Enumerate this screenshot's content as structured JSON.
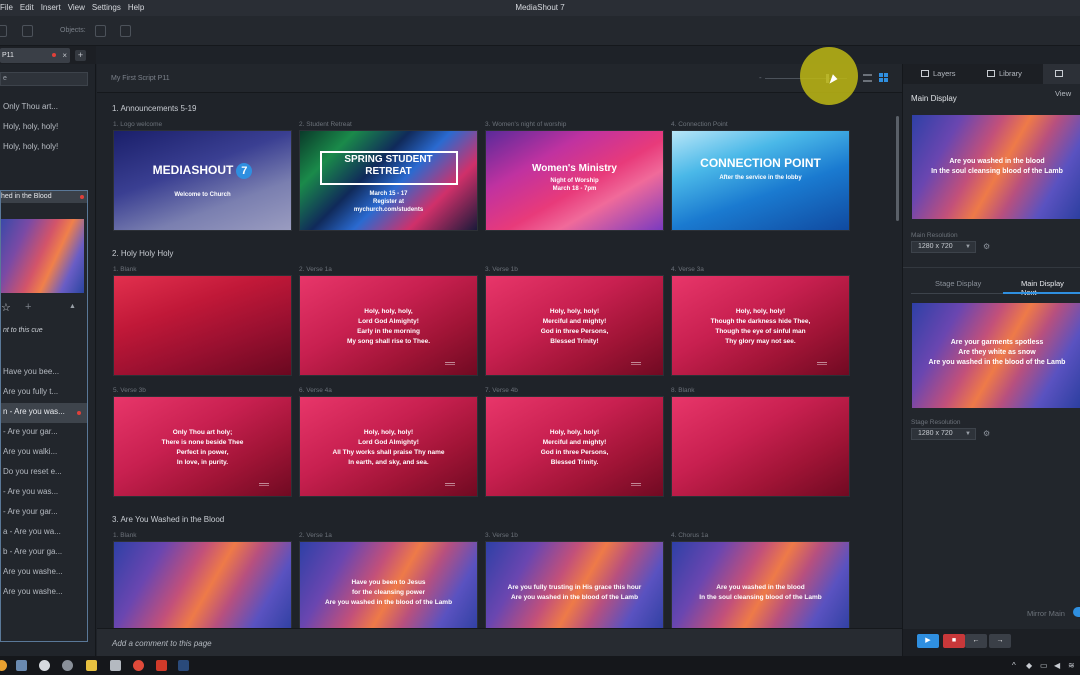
{
  "window": {
    "title": "MediaShout 7"
  },
  "menu": [
    "File",
    "Edit",
    "Insert",
    "View",
    "Settings",
    "Help"
  ],
  "toolbar": {
    "objects_label": "Objects:"
  },
  "tabs": {
    "active_label": "P11",
    "close": "×",
    "add": "+"
  },
  "sidebar": {
    "search_value": "e",
    "top_items": [
      "Only Thou art...",
      "Holy, holy, holy!",
      "Holy, holy, holy!"
    ],
    "cue_title": "hed in the Blood",
    "cue_note": "nt to this cue",
    "cue_items": [
      "Have you bee...",
      "Are you fully t...",
      "n - Are you was...",
      "- Are your gar...",
      "Are you walki...",
      "Do you reset e...",
      "- Are you was...",
      "- Are your gar...",
      "a - Are you wa...",
      "b - Are your ga...",
      "Are you washe...",
      "Are you washe..."
    ],
    "selected_index": 2
  },
  "main": {
    "script_title": "My First Script P11",
    "comment_placeholder": "Add a comment to this page",
    "sections": [
      {
        "title": "1. Announcements 5-19",
        "slides": [
          {
            "label": "1. Logo welcome",
            "bg": "ms",
            "brand": "MEDIASHOUT",
            "badge": "7",
            "lines": [
              "Welcome to Church"
            ]
          },
          {
            "label": "2. Student Retreat",
            "bg": "spring",
            "title": "SPRING STUDENT RETREAT",
            "lines": [
              "March 15 - 17",
              "Register at",
              "mychurch.com/students"
            ]
          },
          {
            "label": "3. Women's night of worship",
            "bg": "women",
            "title": "Women's Ministry",
            "lines": [
              "Night of Worship",
              "March  18 - 7pm"
            ]
          },
          {
            "label": "4. Connection Point",
            "bg": "conn",
            "title": "CONNECTION POINT",
            "lines": [
              "After the service in the lobby"
            ]
          }
        ]
      },
      {
        "title": "2. Holy Holy Holy",
        "slides": [
          {
            "label": "1. Blank",
            "bg": "red",
            "lines": []
          },
          {
            "label": "2. Verse 1a",
            "bg": "pinkred",
            "lines": [
              "Holy, holy, holy,",
              "Lord God Almighty!",
              "Early in the morning",
              "My song shall rise to Thee."
            ]
          },
          {
            "label": "3. Verse 1b",
            "bg": "pinkred",
            "lines": [
              "Holy, holy, holy!",
              "Merciful and mighty!",
              "God in three Persons,",
              "Blessed Trinity!"
            ]
          },
          {
            "label": "4. Verse 3a",
            "bg": "pinkred",
            "lines": [
              "Holy, holy, holy!",
              "Though the darkness hide Thee,",
              "Though the eye of sinful man",
              "Thy glory may not see."
            ]
          },
          {
            "label": "5. Verse 3b",
            "bg": "pinkred",
            "lines": [
              "Only Thou art holy;",
              "There is none beside Thee",
              "Perfect in power,",
              "In love, in purity."
            ]
          },
          {
            "label": "6. Verse 4a",
            "bg": "pinkred",
            "lines": [
              "Holy, holy, holy!",
              "Lord God Almighty!",
              "All Thy works shall praise Thy name",
              "In earth, and sky, and sea."
            ]
          },
          {
            "label": "7. Verse 4b",
            "bg": "pinkred",
            "lines": [
              "Holy, holy, holy!",
              "Merciful and mighty!",
              "God in three Persons,",
              "Blessed Trinity."
            ]
          },
          {
            "label": "8. Blank",
            "bg": "pinkred",
            "lines": []
          }
        ]
      },
      {
        "title": "3. Are You Washed in the Blood",
        "slides": [
          {
            "label": "1. Blank",
            "bg": "wash",
            "lines": []
          },
          {
            "label": "2. Verse 1a",
            "bg": "wash",
            "lines": [
              "Have you been to Jesus",
              "for the cleansing power",
              "Are you washed in the blood of the Lamb"
            ]
          },
          {
            "label": "3. Verse 1b",
            "bg": "wash",
            "lines": [
              "Are you fully trusting in His grace this hour",
              "Are you washed in the blood of the Lamb"
            ]
          },
          {
            "label": "4. Chorus 1a",
            "bg": "wash",
            "lines": [
              "Are you washed in the blood",
              "In the soul cleansing blood of the Lamb"
            ]
          }
        ]
      }
    ]
  },
  "right_panel": {
    "tabs": [
      "Layers",
      "Library",
      "View"
    ],
    "main_display_title": "Main Display",
    "main_preview_lines": [
      "Are you washed in the blood",
      "In the soul cleansing blood of the Lamb"
    ],
    "main_resolution_label": "Main Resolution",
    "main_resolution_value": "1280 x 720",
    "subtabs": [
      "Stage Display",
      "Main Display Next"
    ],
    "next_preview_lines": [
      "Are your garments spotless",
      "Are they white as snow",
      "Are you washed in the blood of the Lamb"
    ],
    "stage_resolution_label": "Stage Resolution",
    "stage_resolution_value": "1280 x 720",
    "mirror_label": "Mirror Main"
  },
  "colors": {
    "accent": "#2f8fe0",
    "record": "#e0403a",
    "cursor_highlight": "#bfb914"
  },
  "icons": [
    "star-icon",
    "plus-icon",
    "gear-icon",
    "play-icon",
    "stop-icon",
    "arrow-left-icon",
    "arrow-right-icon",
    "list-view-icon",
    "grid-view-icon"
  ]
}
